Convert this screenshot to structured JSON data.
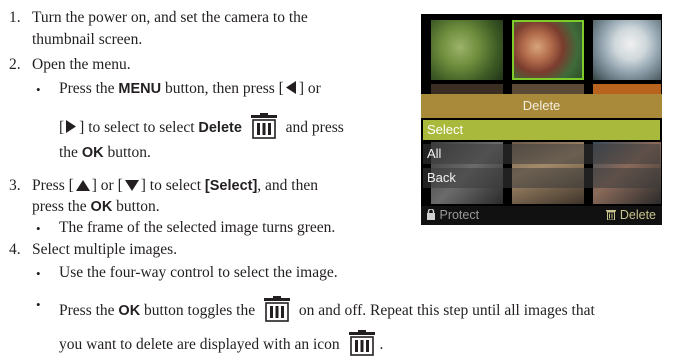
{
  "steps": [
    {
      "number": "1.",
      "lines": [
        "Turn the power on, and set the camera to the",
        "thumbnail screen."
      ]
    },
    {
      "number": "2.",
      "line": "Open the menu."
    },
    {
      "number": "3.",
      "line1_a": "Press [",
      "line1_b": "] or [",
      "line1_c": "] to select",
      "line1_d": "[Select]",
      "line1_e": ", and then",
      "line2_a": "press the",
      "line2_b": "OK",
      "line2_c": "button."
    },
    {
      "number": "4.",
      "line": "Select multiple images."
    }
  ],
  "step2_bullet": {
    "line1_a": "Press the",
    "line1_b": "MENU",
    "line1_c": "button, then press [",
    "line1_d": "] or",
    "line2_a": "[",
    "line2_b": "] to select to select",
    "line2_c": "Delete",
    "line2_d": "and press",
    "line3_a": "the",
    "line3_b": "OK",
    "line3_c": "button."
  },
  "step3_bullet": "The frame of the selected image turns green.",
  "step4_bullets": {
    "first": "Use the four-way control to select the image.",
    "second_a": "Press the",
    "second_b": "OK",
    "second_c": "button toggles the",
    "second_d": "on and off. Repeat this step until all images that",
    "third_a": "you want to delete are displayed with an icon",
    "third_b": "."
  },
  "bullet_char": "•",
  "camera_screen": {
    "menu_title": "Delete",
    "items": [
      "Select",
      "All",
      "Back"
    ],
    "footer_left": "Protect",
    "footer_right": "Delete"
  },
  "icons": {
    "trash": "trash-can-icon",
    "left": "left-triangle-icon",
    "right": "right-triangle-icon",
    "up": "up-triangle-icon",
    "down": "down-triangle-icon",
    "lock": "lock-icon"
  },
  "colors": {
    "selection_frame": "#7ecb2b",
    "menu_title_bg": "#a98a3a",
    "menu_highlight": "#a9b93b"
  }
}
